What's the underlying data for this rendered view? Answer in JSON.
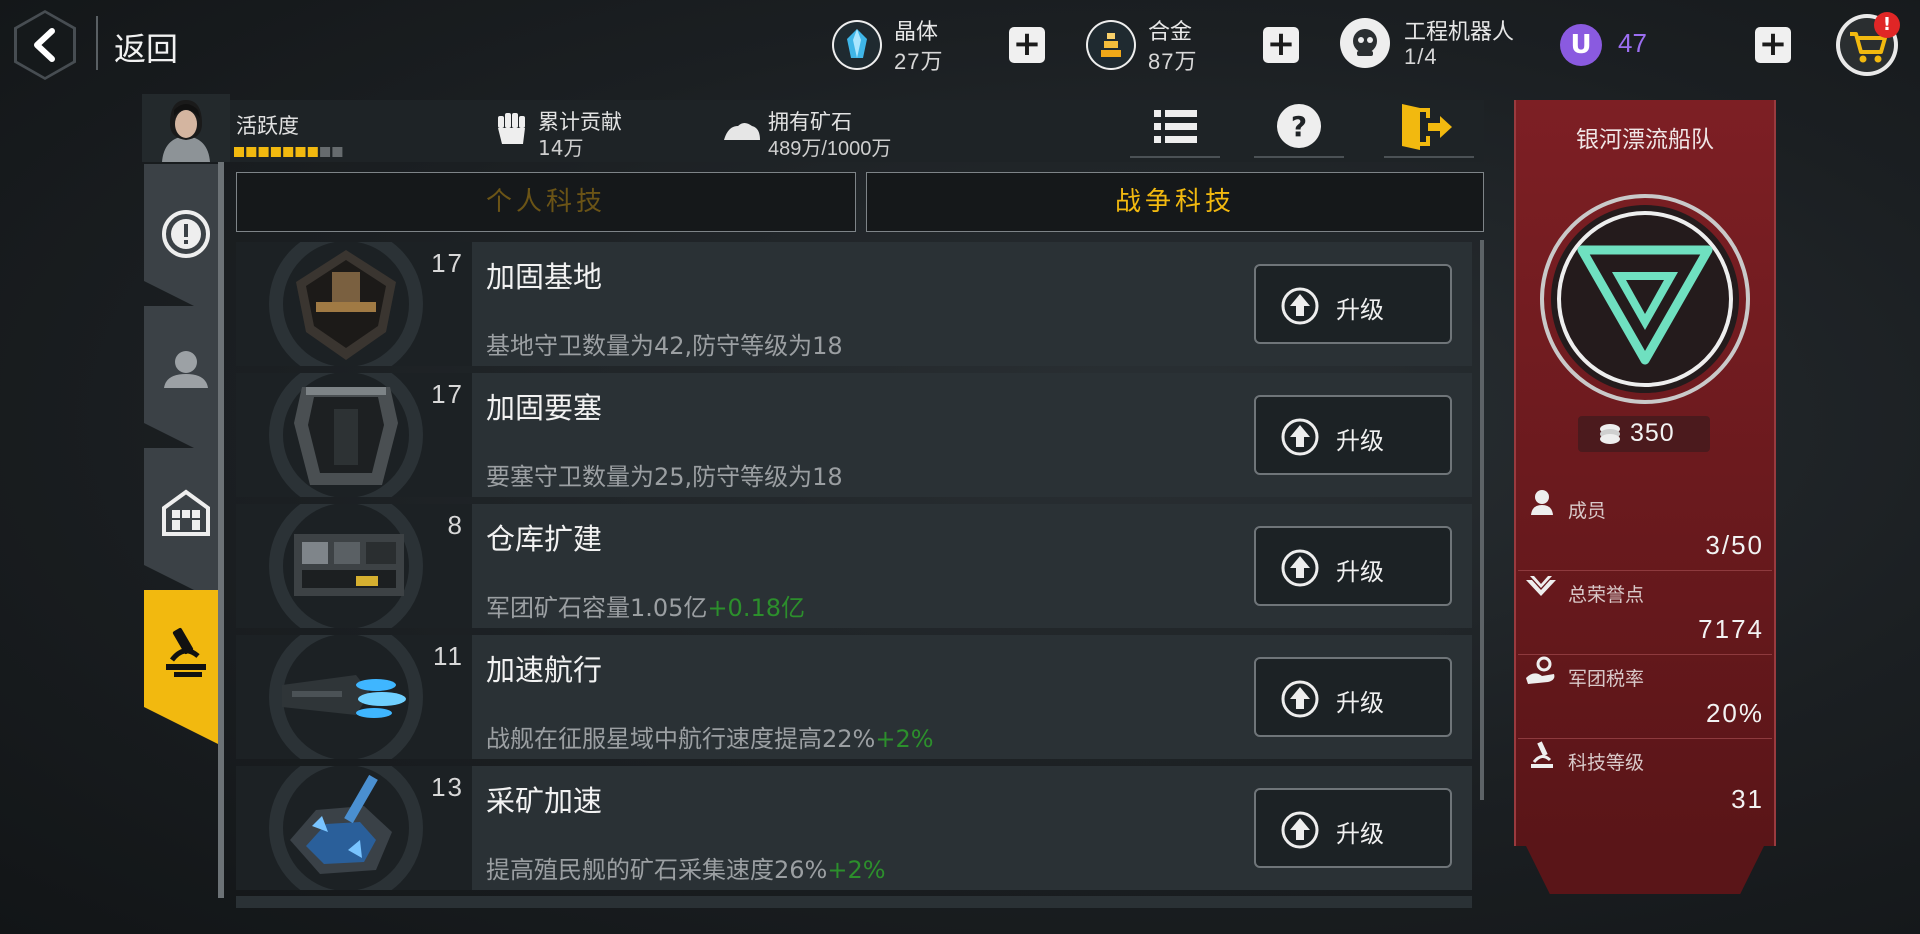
{
  "header": {
    "back_label": "返回",
    "resources": [
      {
        "name": "晶体",
        "value": "27万",
        "icon": "crystal-icon",
        "color": "#3fb6e8"
      },
      {
        "name": "合金",
        "value": "87万",
        "icon": "alloy-icon",
        "color": "#f0a818"
      },
      {
        "name": "工程机器人",
        "value": "1/4",
        "icon": "robot-icon"
      }
    ],
    "premium": {
      "icon_letter": "U",
      "value": "47",
      "color": "#8a5ae0"
    },
    "shop_badge": "!"
  },
  "info_bar": {
    "activity_label": "活跃度",
    "activity_level": 0.78,
    "contribution_label": "累计贡献",
    "contribution_value": "14万",
    "ore_label": "拥有矿石",
    "ore_value": "489万/1000万"
  },
  "category_tabs": [
    {
      "label": "个人科技",
      "active": false
    },
    {
      "label": "战争科技",
      "active": true
    }
  ],
  "tech_list": [
    {
      "title": "加固基地",
      "level": "17",
      "desc": "基地守卫数量为42,防守等级为18",
      "bonus": "",
      "button": "升级"
    },
    {
      "title": "加固要塞",
      "level": "17",
      "desc": "要塞守卫数量为25,防守等级为18",
      "bonus": "",
      "button": "升级"
    },
    {
      "title": "仓库扩建",
      "level": "8",
      "desc": "军团矿石容量1.05亿",
      "bonus": "+0.18亿",
      "button": "升级"
    },
    {
      "title": "加速航行",
      "level": "11",
      "desc": "战舰在征服星域中航行速度提高22%",
      "bonus": "+2%",
      "button": "升级"
    },
    {
      "title": "采矿加速",
      "level": "13",
      "desc": "提高殖民舰的矿石采集速度26%",
      "bonus": "+2%",
      "button": "升级"
    }
  ],
  "legion": {
    "name": "银河漂流船队",
    "power": "350",
    "accent_color": "#6fe0c0",
    "stats": [
      {
        "label": "成员",
        "value": "3/50",
        "icon": "member-icon"
      },
      {
        "label": "总荣誉点",
        "value": "7174",
        "icon": "wings-icon"
      },
      {
        "label": "军团税率",
        "value": "20%",
        "icon": "tax-icon"
      },
      {
        "label": "科技等级",
        "value": "31",
        "icon": "microscope-icon"
      }
    ]
  }
}
